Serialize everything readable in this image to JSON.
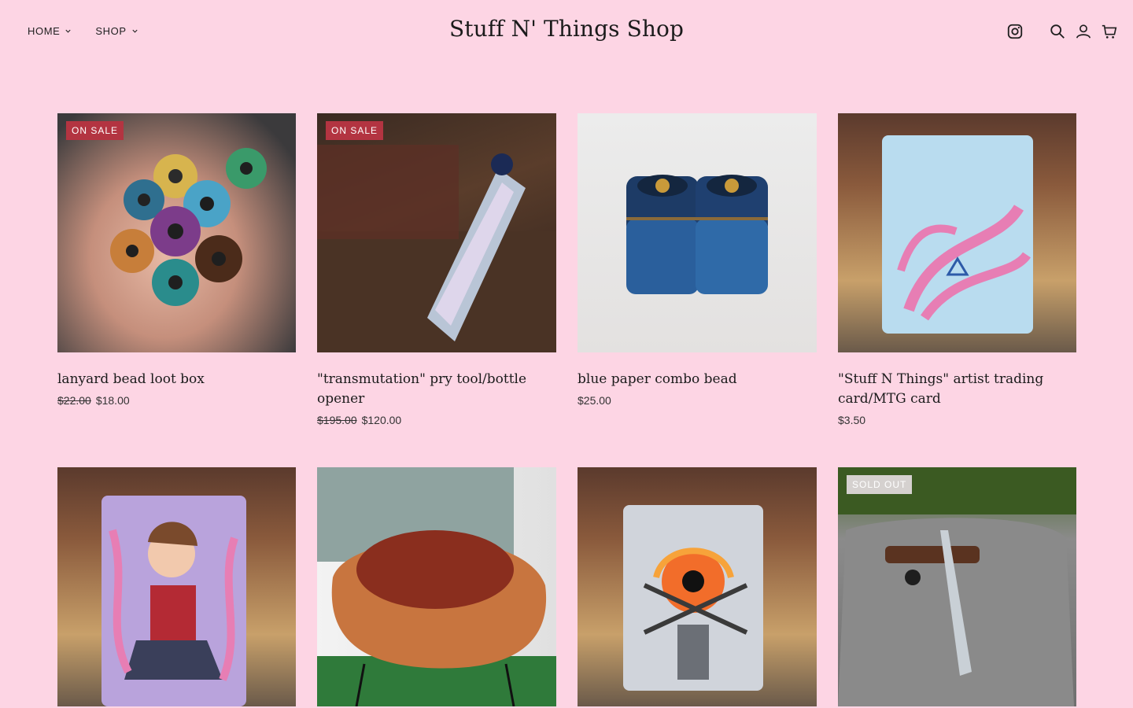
{
  "header": {
    "logo": "Stuff N' Things Shop",
    "nav": [
      {
        "label": "HOME"
      },
      {
        "label": "SHOP"
      }
    ]
  },
  "products": [
    {
      "title": "lanyard bead loot box",
      "old_price": "$22.00",
      "price": "$18.00",
      "badge": "ON SALE"
    },
    {
      "title": "\"transmutation\" pry tool/bottle opener",
      "old_price": "$195.00",
      "price": "$120.00",
      "badge": "ON SALE"
    },
    {
      "title": "blue paper combo bead",
      "old_price": "",
      "price": "$25.00",
      "badge": ""
    },
    {
      "title": "\"Stuff N Things\" artist trading card/MTG card",
      "old_price": "",
      "price": "$3.50",
      "badge": ""
    },
    {
      "title": "",
      "old_price": "",
      "price": "",
      "badge": ""
    },
    {
      "title": "",
      "old_price": "",
      "price": "",
      "badge": ""
    },
    {
      "title": "",
      "old_price": "",
      "price": "",
      "badge": ""
    },
    {
      "title": "",
      "old_price": "",
      "price": "",
      "badge": "SOLD OUT"
    }
  ],
  "colors": {
    "background": "#fdd5e4",
    "sale_badge": "#b33441",
    "sold_badge": "#d5d1cf"
  },
  "icons": [
    "instagram-icon",
    "search-icon",
    "account-icon",
    "cart-icon",
    "chevron-down-icon"
  ]
}
